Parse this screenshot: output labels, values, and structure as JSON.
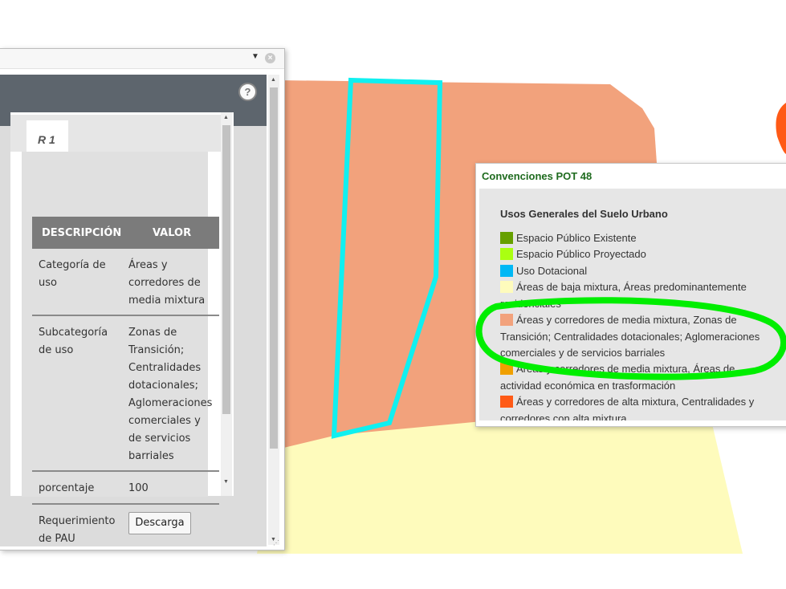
{
  "colors": {
    "map_salmon": "#f2a27c",
    "map_yellow": "#fefbbc",
    "map_orange_red": "#ff5a16",
    "selection_outline": "#10f0f0",
    "highlight_ellipse": "#00ee00",
    "panel_header": "#5d656d",
    "table_header": "#7b7b7b",
    "legend_title": "#1f6b1f"
  },
  "info_panel": {
    "titlebar_icons": [
      "dropdown-arrow-icon",
      "close-icon"
    ],
    "help_label": "?",
    "tab_label": "R 1",
    "table": {
      "headers": {
        "description": "DESCRIPCIÓN",
        "value": "VALOR"
      },
      "rows": [
        {
          "key": "Categoría de\nuso",
          "value": "Áreas y\ncorredores de\nmedia mixtura"
        },
        {
          "key": "Subcategoría\nde uso",
          "value": "Zonas de\nTransición;\nCentralidades\ndotacionales;\nAglomeraciones\ncomerciales y\nde servicios\nbarriales"
        },
        {
          "key": "porcentaje",
          "value": "100"
        },
        {
          "key": "Requerimiento\nde PAU",
          "value": ""
        }
      ]
    },
    "download_button": "Descarga"
  },
  "legend": {
    "title": "Convenciones POT 48",
    "heading": "Usos Generales del Suelo Urbano",
    "items": [
      {
        "color": "#66a000",
        "label": "Espacio Público Existente"
      },
      {
        "color": "#aaff11",
        "label": "Espacio Público Proyectado"
      },
      {
        "color": "#00b8f5",
        "label": "Uso Dotacional"
      },
      {
        "color": "#fefbbc",
        "label": "Áreas de baja mixtura, Áreas predominantemente residenciales"
      },
      {
        "color": "#f2a27c",
        "label": "Áreas y corredores de media mixtura, Zonas de Transición; Centralidades dotacionales; Aglomeraciones comerciales y de servicios barriales"
      },
      {
        "color": "#f0a000",
        "label": "Áreas y corredores de media mixtura, Áreas de actividad económica en trasformación"
      },
      {
        "color": "#ff5a16",
        "label": "Áreas y corredores de alta mixtura, Centralidades y corredores con alta mixtura"
      }
    ]
  }
}
